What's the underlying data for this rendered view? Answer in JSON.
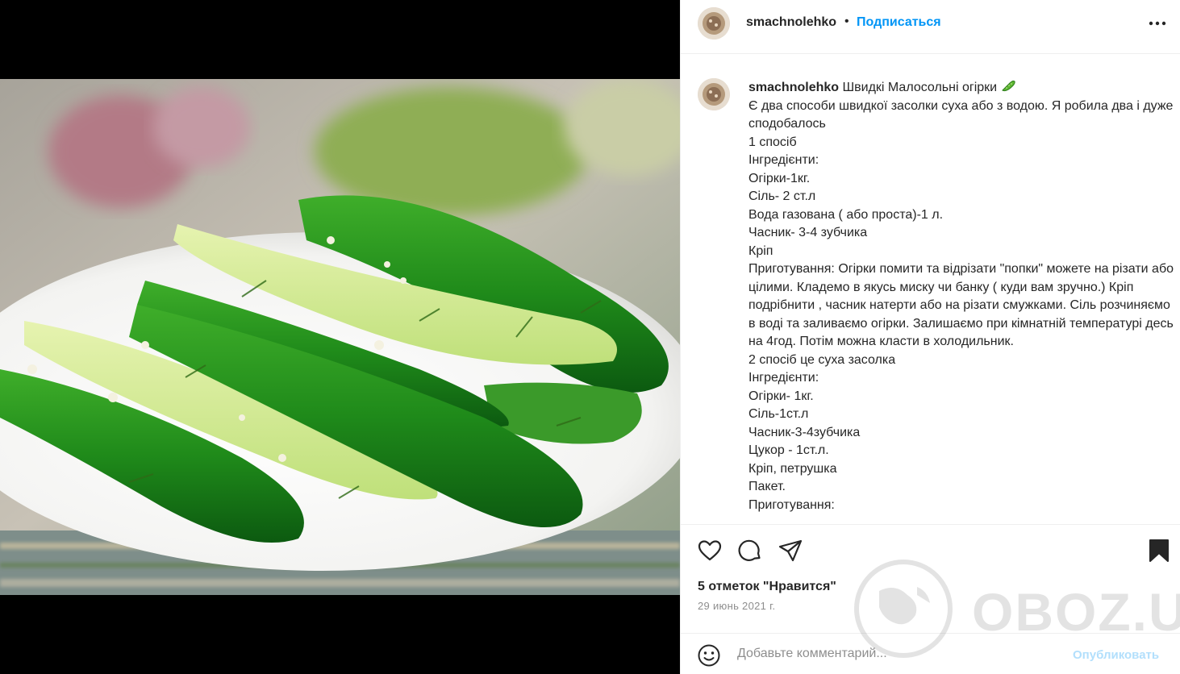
{
  "post": {
    "username": "smachnolehko",
    "separator": "•",
    "follow_label": "Подписаться",
    "caption_title": "Швидкі Малосольні огірки",
    "caption_lines": [
      "Є два способи швидкої засолки суха або з водою. Я робила два і дуже сподобалось",
      "1 спосіб",
      "Інгредієнти:",
      "Огірки-1кг.",
      "Сіль- 2 ст.л",
      "Вода газована ( або проста)-1 л.",
      "Часник- 3-4 зубчика",
      "Кріп",
      "Приготування: Огірки помити та відрізати \"попки\" можете на різати або цілими. Кладемо в якусь миску чи банку ( куди вам зручно.) Кріп подрібнити , часник натерти або на різати смужками. Сіль розчиняємо в воді та заливаємо огірки. Залишаємо при кімнатній температурі десь на 4год. Потім можна класти в холодильник.",
      "2 спосіб це суха засолка",
      "Інгредієнти:",
      "Огірки- 1кг.",
      "Сіль-1ст.л",
      "Часник-3-4зубчика",
      "Цукор - 1ст.л.",
      "Кріп, петрушка",
      "Пакет.",
      "Приготування:"
    ],
    "likes_text": "5 отметок \"Нравится\"",
    "date_text": "29 июнь 2021 г.",
    "comment_placeholder": "Добавьте комментарий...",
    "publish_label": "Опубликовать"
  },
  "icons": {
    "more": "more-horizontal-icon",
    "like": "heart-icon",
    "comment": "comment-icon",
    "share": "share-icon",
    "save": "bookmark-icon",
    "emoji": "emoji-icon",
    "cucumber": "cucumber-emoji"
  },
  "watermark": {
    "text": "OBOZ.UA"
  },
  "colors": {
    "accent": "#0095f6",
    "publish_disabled": "#b2dffc",
    "text": "#262626",
    "muted": "#8e8e8e",
    "divider": "#efefef"
  }
}
